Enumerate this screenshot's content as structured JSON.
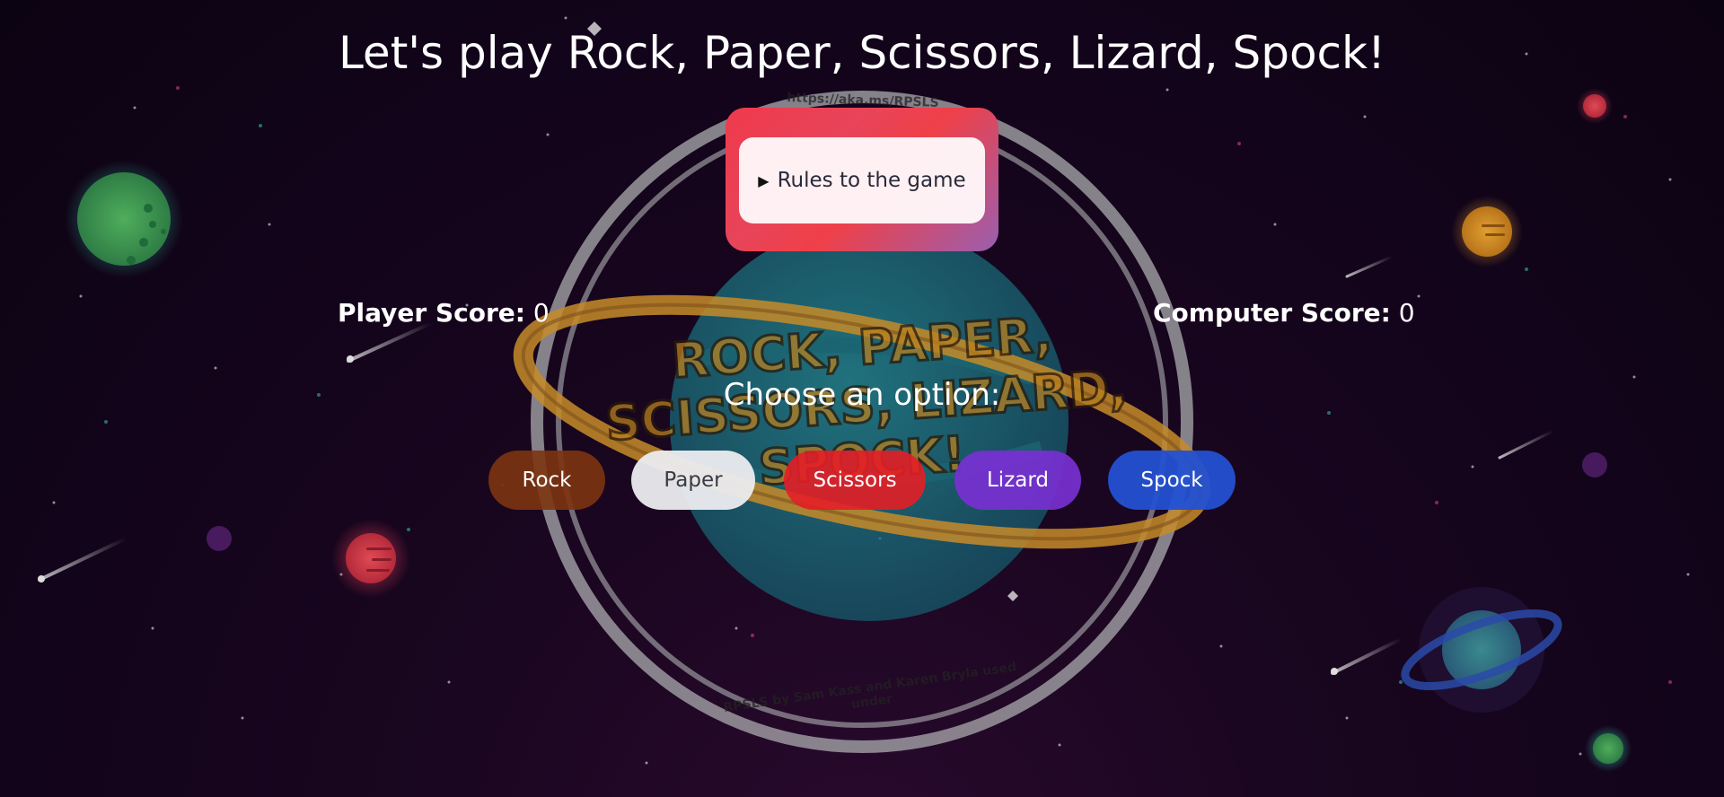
{
  "header": {
    "title": "Let's play Rock, Paper, Scissors, Lizard, Spock!"
  },
  "logo": {
    "top_text": "https://aka.ms/RPSLS",
    "main_text_line1": "ROCK, PAPER,",
    "main_text_line2": "SCISSORS, LIZARD,",
    "main_text_line3": "SPOCK!",
    "bottom_text": "RPSLS by Sam Kass and Karen Bryla used under"
  },
  "rules": {
    "label": "Rules to the game",
    "expanded": false
  },
  "scores": {
    "player_label": "Player Score:",
    "player_value": "0",
    "computer_label": "Computer Score:",
    "computer_value": "0"
  },
  "choices": {
    "prompt": "Choose an option:",
    "options": [
      {
        "label": "Rock",
        "color": "#7c3410"
      },
      {
        "label": "Paper",
        "color": "#ececf0"
      },
      {
        "label": "Scissors",
        "color": "#e41e26"
      },
      {
        "label": "Lizard",
        "color": "#7830d2"
      },
      {
        "label": "Spock",
        "color": "#2350d2"
      }
    ]
  },
  "colors": {
    "background": "#12041a",
    "rules_gradient_start": "#ef3a4b",
    "rules_gradient_end": "#9a5fb0",
    "logo_ring": "#a8a8ac",
    "logo_ribbon": "#d99a2a",
    "logo_planet": "#1f7f8a"
  }
}
